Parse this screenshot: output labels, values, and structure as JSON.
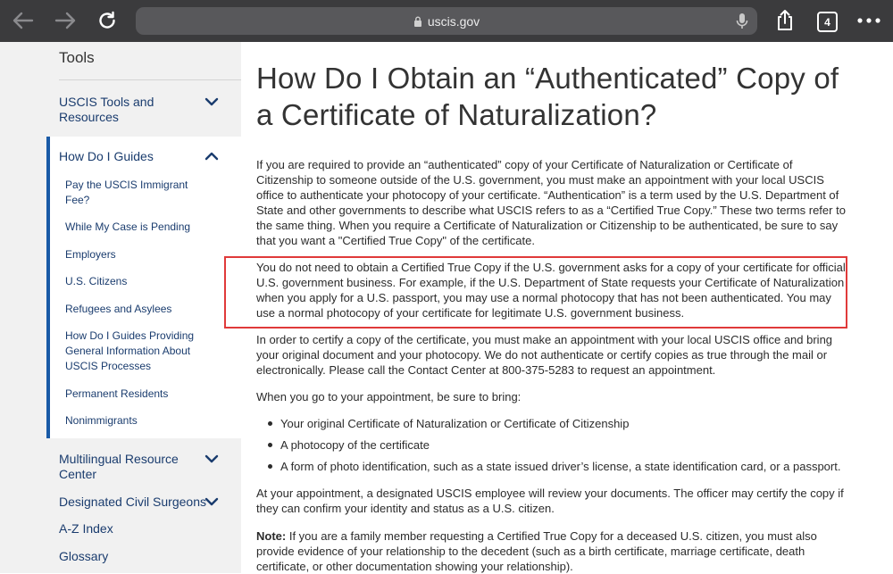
{
  "browser": {
    "url": "uscis.gov",
    "tab_count": "4"
  },
  "sidebar": {
    "title": "Tools",
    "items": [
      {
        "label": "USCIS Tools and Resources"
      },
      {
        "label": "How Do I Guides"
      },
      {
        "label": "Multilingual Resource Center"
      },
      {
        "label": "Designated Civil Surgeons"
      },
      {
        "label": "A-Z Index"
      },
      {
        "label": "Glossary"
      }
    ],
    "subitems": [
      {
        "label": "Pay the USCIS Immigrant Fee?"
      },
      {
        "label": "While My Case is Pending"
      },
      {
        "label": "Employers"
      },
      {
        "label": "U.S. Citizens"
      },
      {
        "label": "Refugees and Asylees"
      },
      {
        "label": "How Do I Guides Providing General Information About USCIS Processes"
      },
      {
        "label": "Permanent Residents"
      },
      {
        "label": "Nonimmigrants"
      }
    ]
  },
  "main": {
    "title": "How Do I Obtain an “Authenticated” Copy of a Certificate of Naturalization?",
    "paragraphs": [
      "If you are required to provide an “authenticated” copy of your Certificate of Naturalization or Certificate of Citizenship to someone outside of the U.S. government, you must make an appointment with your local USCIS office to authenticate your photocopy of your certificate.  “Authentication” is a term used by the U.S. Department of State and other governments to describe what USCIS refers to as a “Certified True Copy.” These two terms refer to the same thing. When you require a Certificate of Naturalization or Citizenship to be authenticated, be sure to say that you want a \"Certified True Copy\" of the certificate.",
      "You do not need to obtain a Certified True Copy if the U.S. government asks for a copy of your certificate for official U.S. government business. For example, if the U.S. Department of State requests your Certificate of Naturalization when you apply for a U.S. passport, you may use a normal photocopy that has not been authenticated. You may use a normal photocopy of your certificate for legitimate U.S. government business.",
      "In order to certify a copy of the certificate, you must make an appointment with your local USCIS office and bring your original document and your photocopy. We do not authenticate or certify copies as true through the mail or electronically. Please call the Contact Center at 800-375-5283 to request an appointment.",
      "When you go to your appointment, be sure to bring:"
    ],
    "bullets": [
      "Your original Certificate of Naturalization or Certificate of Citizenship",
      "A photocopy of the certificate",
      "A form of photo identification, such as a state issued driver’s license, a state identification card, or a passport."
    ],
    "after_bullets": "At your appointment, a designated USCIS employee will review your documents. The officer may certify the copy if they can confirm your identity and status as a U.S. citizen.",
    "note_label": "Note:",
    "note_text": " If you are a family member requesting a Certified True Copy for a deceased U.S. citizen, you must also provide evidence of your       relationship to the decedent (such as a birth certificate, marriage certificate, death certificate, or other documentation showing your relationship)."
  },
  "colors": {
    "toolbar": "#3b3b3d",
    "link": "#1a3c6e",
    "active_bar": "#1a5aa6",
    "highlight": "#e03a3a"
  }
}
